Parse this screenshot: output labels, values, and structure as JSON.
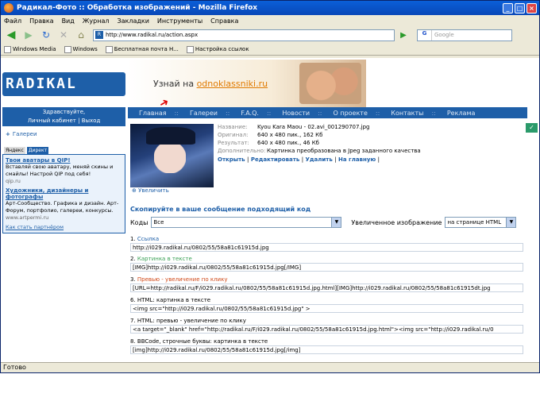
{
  "window": {
    "title": "Радикал-Фото :: Обработка изображений - Mozilla Firefox"
  },
  "menu": [
    "Файл",
    "Правка",
    "Вид",
    "Журнал",
    "Закладки",
    "Инструменты",
    "Справка"
  ],
  "address": {
    "url": "http://www.radikal.ru/action.aspx"
  },
  "search": {
    "placeholder": "Google"
  },
  "bookmarks": [
    "Windows Media",
    "Windows",
    "Бесплатная почта H...",
    "Настройка ссылок"
  ],
  "site": {
    "logo": "RADIKAL ФОТО",
    "banner_text": "Узнай на",
    "banner_link": "odnoklassniki.ru",
    "welcome": "Здравствуйте,",
    "cabinet": "Личный кабинет",
    "exit": "Выход",
    "gallery": "Галереи",
    "nav": [
      "Главная",
      "Галереи",
      "F.A.Q.",
      "Новости",
      "О проекте",
      "Контакты",
      "Реклама"
    ]
  },
  "ads": {
    "tabs": [
      "Яндекс",
      "Директ"
    ],
    "items": [
      {
        "title": "Твои аватары в QIP!",
        "desc": "Вставляй свою аватару, меняй скины и смайлы! Настрой QIP под себя!",
        "url": "qip.ru"
      },
      {
        "title": "Художники, дизайнеры и фотографы",
        "desc": "Арт-Сообщество. Графика и дизайн. Арт-Форум, портфолио, галереи, конкурсы.",
        "url": "www.artpermi.ru"
      }
    ],
    "partner": "Как стать партнёром"
  },
  "image": {
    "name_k": "Название:",
    "name_v": "Kyou Kara Maou - 02.avi_001290707.jpg",
    "orig_k": "Оригинал:",
    "orig_v": "640 x 480 пик., 162 Кб",
    "res_k": "Результат:",
    "res_v": "640 x 480 пик., 46 Кб",
    "extra_k": "Дополнительно:",
    "extra_v": "Картинка преобразована в Jpeg заданного качества",
    "actions": [
      "Открыть",
      "Редактировать",
      "Удалить",
      "На главную"
    ],
    "enlarge": "Увеличить"
  },
  "copy": {
    "heading": "Скопируйте в ваше сообщение подходящий код",
    "codes_label": "Коды",
    "codes_value": "Все",
    "enlarged_label": "Увеличенное изображение",
    "enlarged_value": "на странице HTML"
  },
  "items": [
    {
      "num": "1.",
      "label": "Ссылка",
      "code": "http://i029.radikal.ru/0802/55/58a81c61915d.jpg"
    },
    {
      "num": "2.",
      "label": "Картинка в тексте",
      "code": "[IMG]http://i029.radikal.ru/0802/55/58a81c61915d.jpg[/IMG]"
    },
    {
      "num": "3.",
      "label": "Превью - увеличение по клику",
      "code": "[URL=http://radikal.ru/F/i029.radikal.ru/0802/55/58a81c61915d.jpg.html][IMG]http://i029.radikal.ru/0802/55/58a81c61915dt.jpg"
    },
    {
      "num": "6.",
      "label": "HTML: картинка в тексте",
      "code": "<img src=\"http://i029.radikal.ru/0802/55/58a81c61915d.jpg\" >"
    },
    {
      "num": "7.",
      "label": "HTML: превью - увеличение по клику",
      "code": "<a target=\"_blank\" href=\"http://radikal.ru/F/i029.radikal.ru/0802/55/58a81c61915d.jpg.html\"><img src=\"http://i029.radikal.ru/0"
    },
    {
      "num": "8.",
      "label": "BBCode, строчные буквы: картинка в тексте",
      "code": "[img]http://i029.radikal.ru/0802/55/58a81c61915d.jpg[/img]"
    }
  ],
  "status": "Готово"
}
